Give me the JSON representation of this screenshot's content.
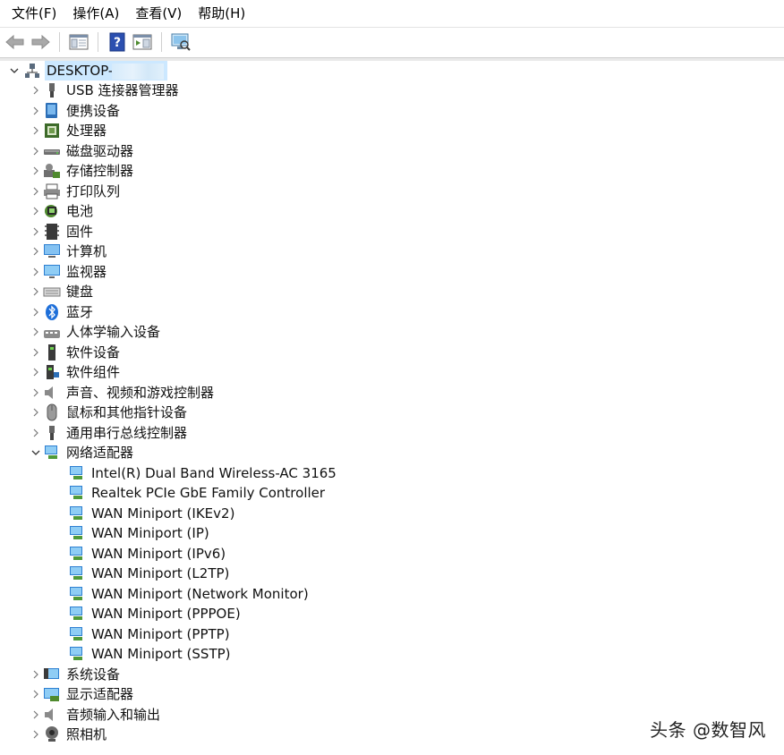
{
  "menubar": {
    "items": [
      "文件(F)",
      "操作(A)",
      "查看(V)",
      "帮助(H)"
    ]
  },
  "toolbar": {
    "buttons": [
      "back-arrow-icon",
      "forward-arrow-icon",
      "show-hide-console-tree-icon",
      "help-icon",
      "properties-pane-icon",
      "scan-hardware-icon"
    ]
  },
  "tree": {
    "root": {
      "label": "DESKTOP-",
      "expanded": true
    },
    "categories": [
      {
        "label": "USB 连接器管理器",
        "icon": "usb-connector-icon",
        "expanded": false
      },
      {
        "label": "便携设备",
        "icon": "portable-device-icon",
        "expanded": false
      },
      {
        "label": "处理器",
        "icon": "processor-icon",
        "expanded": false
      },
      {
        "label": "磁盘驱动器",
        "icon": "disk-drive-icon",
        "expanded": false
      },
      {
        "label": "存储控制器",
        "icon": "storage-controller-icon",
        "expanded": false
      },
      {
        "label": "打印队列",
        "icon": "printer-icon",
        "expanded": false
      },
      {
        "label": "电池",
        "icon": "battery-icon",
        "expanded": false
      },
      {
        "label": "固件",
        "icon": "firmware-icon",
        "expanded": false
      },
      {
        "label": "计算机",
        "icon": "computer-icon",
        "expanded": false
      },
      {
        "label": "监视器",
        "icon": "monitor-icon",
        "expanded": false
      },
      {
        "label": "键盘",
        "icon": "keyboard-icon",
        "expanded": false
      },
      {
        "label": "蓝牙",
        "icon": "bluetooth-icon",
        "expanded": false
      },
      {
        "label": "人体学输入设备",
        "icon": "hid-icon",
        "expanded": false
      },
      {
        "label": "软件设备",
        "icon": "software-device-icon",
        "expanded": false
      },
      {
        "label": "软件组件",
        "icon": "software-component-icon",
        "expanded": false
      },
      {
        "label": "声音、视频和游戏控制器",
        "icon": "speaker-icon",
        "expanded": false
      },
      {
        "label": "鼠标和其他指针设备",
        "icon": "mouse-icon",
        "expanded": false
      },
      {
        "label": "通用串行总线控制器",
        "icon": "usb-controller-icon",
        "expanded": false
      },
      {
        "label": "网络适配器",
        "icon": "network-adapter-icon",
        "expanded": true
      },
      {
        "label": "系统设备",
        "icon": "system-device-icon",
        "expanded": false
      },
      {
        "label": "显示适配器",
        "icon": "display-adapter-icon",
        "expanded": false
      },
      {
        "label": "音频输入和输出",
        "icon": "audio-io-icon",
        "expanded": false
      },
      {
        "label": "照相机",
        "icon": "camera-icon",
        "expanded": false
      }
    ],
    "network_adapters": [
      "Intel(R) Dual Band Wireless-AC 3165",
      "Realtek PCIe GbE Family Controller",
      "WAN Miniport (IKEv2)",
      "WAN Miniport (IP)",
      "WAN Miniport (IPv6)",
      "WAN Miniport (L2TP)",
      "WAN Miniport (Network Monitor)",
      "WAN Miniport (PPPOE)",
      "WAN Miniport (PPTP)",
      "WAN Miniport (SSTP)"
    ]
  },
  "watermark": "头条 @数智风"
}
